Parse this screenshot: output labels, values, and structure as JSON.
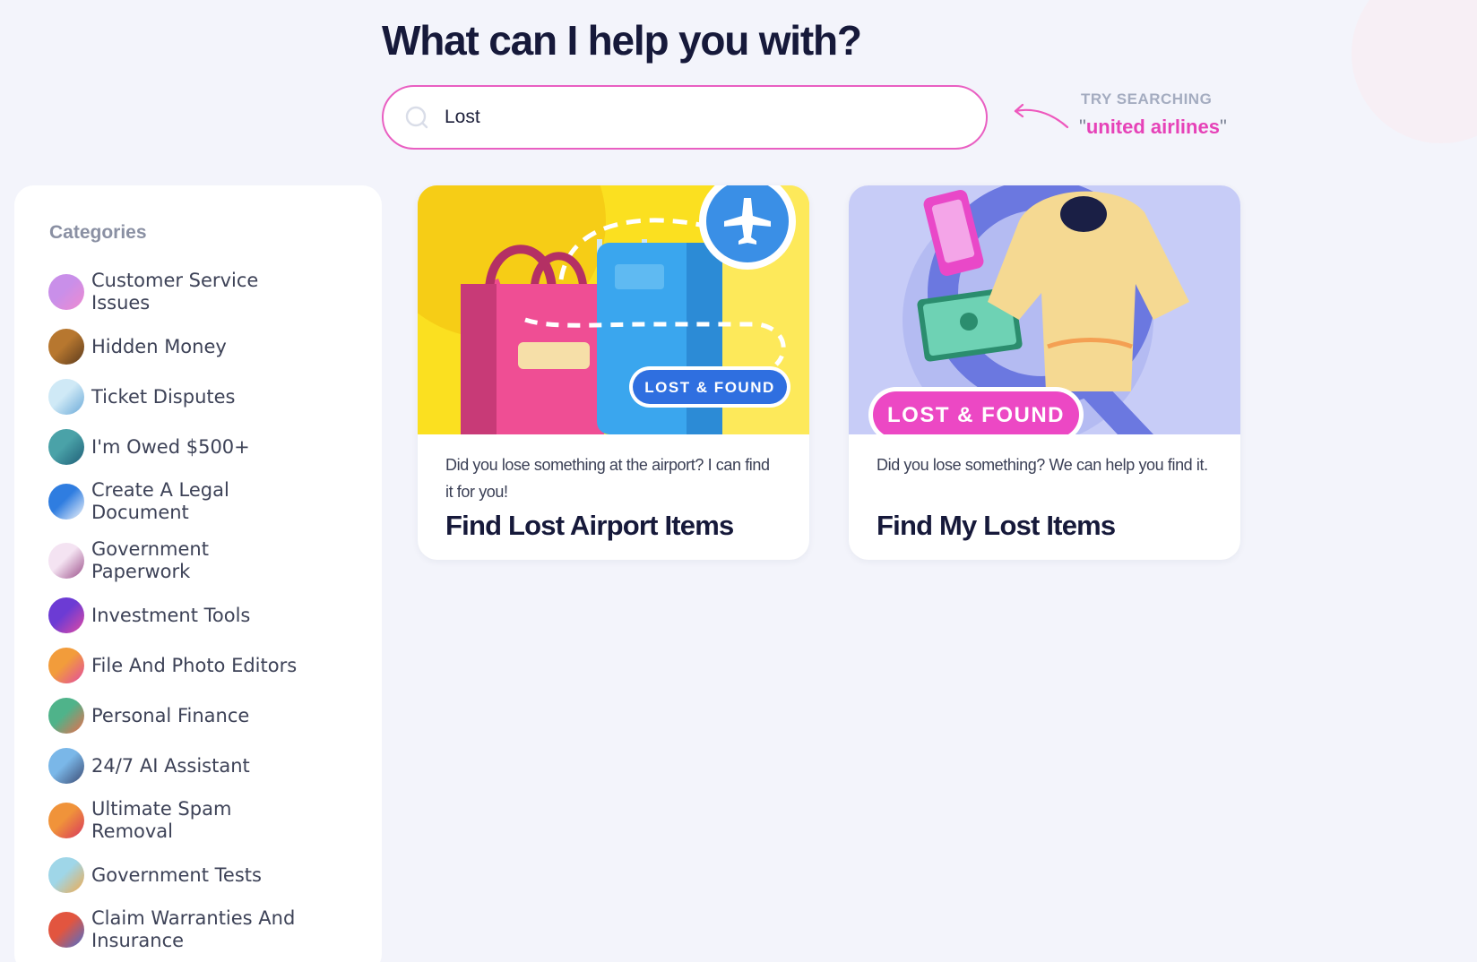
{
  "headline": "What can I help you with?",
  "search": {
    "value": "Lost",
    "placeholder": ""
  },
  "hint": {
    "label": "TRY SEARCHING",
    "term": "united airlines",
    "quote": "\""
  },
  "sidebar": {
    "title": "Categories",
    "items": [
      {
        "label": "Customer Service Issues",
        "icon": "customer-service-icon",
        "colors": [
          "#c98fe9",
          "#ef8ad0"
        ]
      },
      {
        "label": "Hidden Money",
        "icon": "treasure-chest-icon",
        "colors": [
          "#b7772f",
          "#5b3a1d"
        ]
      },
      {
        "label": "Ticket Disputes",
        "icon": "ticket-icon",
        "colors": [
          "#cfe9f6",
          "#6aa9d8"
        ]
      },
      {
        "label": "I'm Owed $500+",
        "icon": "money-icon",
        "colors": [
          "#4aa2a8",
          "#1f5e77"
        ]
      },
      {
        "label": "Create A Legal Document",
        "icon": "document-icon",
        "colors": [
          "#2f7de0",
          "#f2f5fb"
        ]
      },
      {
        "label": "Government Paperwork",
        "icon": "paperwork-icon",
        "colors": [
          "#f4e3f2",
          "#9b4f8a"
        ]
      },
      {
        "label": "Investment Tools",
        "icon": "investment-icon",
        "colors": [
          "#6c3bd4",
          "#e24aa3"
        ]
      },
      {
        "label": "File And Photo Editors",
        "icon": "photo-editor-icon",
        "colors": [
          "#f29c3b",
          "#e24aa3"
        ]
      },
      {
        "label": "Personal Finance",
        "icon": "finance-icon",
        "colors": [
          "#4fb38a",
          "#ef6b4a"
        ]
      },
      {
        "label": "24/7 AI Assistant",
        "icon": "ai-assistant-icon",
        "colors": [
          "#7ab7e8",
          "#3b4a72"
        ]
      },
      {
        "label": "Ultimate Spam Removal",
        "icon": "spam-icon",
        "colors": [
          "#f0933a",
          "#d8365e"
        ]
      },
      {
        "label": "Government Tests",
        "icon": "tests-icon",
        "colors": [
          "#9fd6e8",
          "#f2a94a"
        ]
      },
      {
        "label": "Claim Warranties And Insurance",
        "icon": "warranty-icon",
        "colors": [
          "#e2553f",
          "#4a6fd0"
        ]
      }
    ]
  },
  "cards": [
    {
      "badge": "LOST & FOUND",
      "description": "Did you lose something at the airport? I can find it for you!",
      "title": "Find Lost Airport Items",
      "image": "airport-luggage-illustration"
    },
    {
      "badge": "LOST & FOUND",
      "description": "Did you lose something? We can help you find it.",
      "title": "Find My Lost Items",
      "image": "lost-items-illustration"
    }
  ]
}
